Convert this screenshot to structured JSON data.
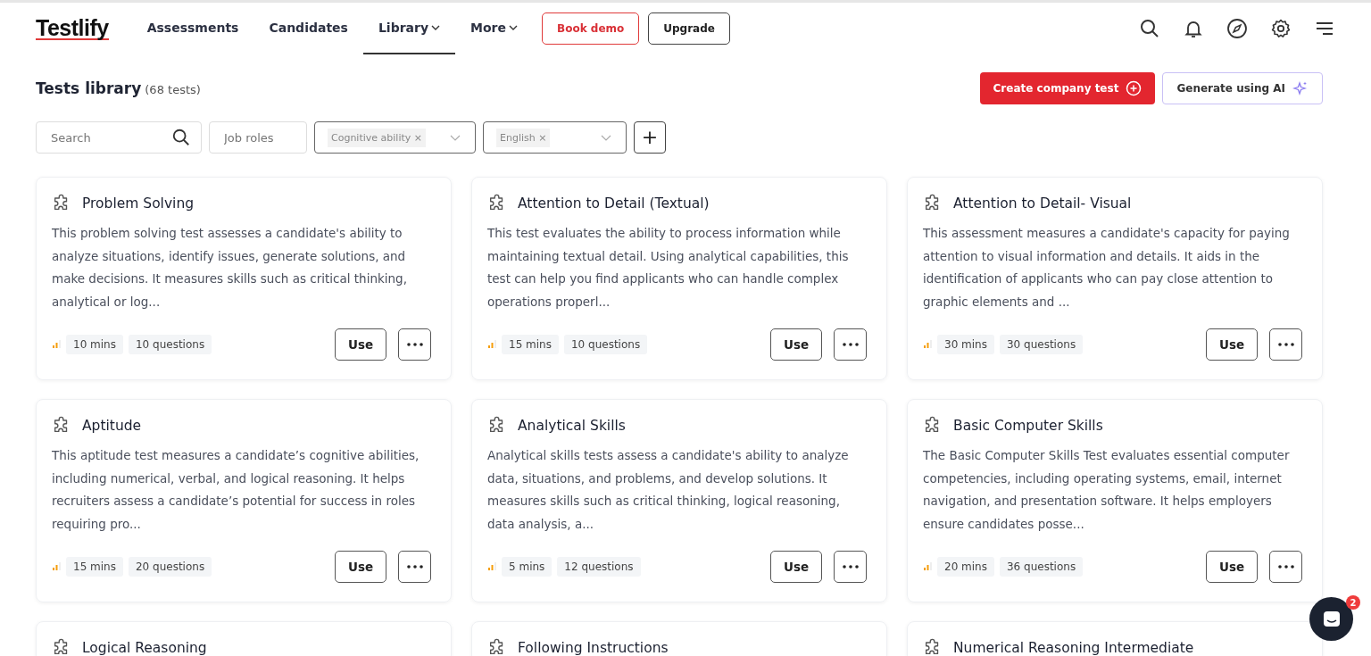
{
  "logo": "Testlify",
  "nav": [
    {
      "label": "Assessments",
      "dropdown": false,
      "selected": false
    },
    {
      "label": "Candidates",
      "dropdown": false,
      "selected": false
    },
    {
      "label": "Library",
      "dropdown": true,
      "selected": true
    },
    {
      "label": "More",
      "dropdown": true,
      "selected": false
    }
  ],
  "nav_buttons": [
    {
      "label": "Book demo",
      "kind": "outline-red"
    },
    {
      "label": "Upgrade",
      "kind": "outline"
    }
  ],
  "page": {
    "title": "Tests library",
    "count": "(68 tests)"
  },
  "actions": [
    {
      "label": "Create company test",
      "kind": "primary"
    },
    {
      "label": "Generate using AI",
      "kind": "ai"
    }
  ],
  "filters": {
    "search": {
      "placeholder": "Search"
    },
    "job_roles": {
      "placeholder": "Job roles"
    },
    "selects": [
      {
        "chip": "Cognitive ability ×"
      },
      {
        "chip": "English ×"
      }
    ],
    "add": "+"
  },
  "tests": [
    {
      "title": "Problem Solving",
      "description": "This problem solving test assesses a candidate's ability to analyze situations, identify issues, generate solutions, and make decisions. It measures skills such as critical thinking, analytical or log...",
      "duration": "10 mins",
      "questions": "10 questions",
      "use": "Use"
    },
    {
      "title": "Attention to Detail (Textual)",
      "description": "This test evaluates the ability to process information while maintaining textual detail. Using analytical capabilities, this test can help you find applicants who can handle complex operations properl...",
      "duration": "15 mins",
      "questions": "10 questions",
      "use": "Use"
    },
    {
      "title": "Attention to Detail- Visual",
      "description": "This assessment measures a candidate's capacity for paying attention to visual information and details. It aids in the identification of applicants who can pay close attention to graphic elements and ...",
      "duration": "30 mins",
      "questions": "30 questions",
      "use": "Use"
    },
    {
      "title": "Aptitude",
      "description": "This aptitude test measures a candidate’s cognitive abilities, including numerical, verbal, and logical reasoning. It helps recruiters assess a candidate’s potential for success in roles requiring pro...",
      "duration": "15 mins",
      "questions": "20 questions",
      "use": "Use"
    },
    {
      "title": "Analytical Skills",
      "description": "Analytical skills tests assess a candidate's ability to analyze data, situations, and problems, and develop solutions. It measures skills such as critical thinking, logical reasoning, data analysis, a...",
      "duration": "5 mins",
      "questions": "12 questions",
      "use": "Use"
    },
    {
      "title": "Basic Computer Skills",
      "description": "The Basic Computer Skills Test evaluates essential computer competencies, including operating systems, email, internet navigation, and presentation software. It helps employers ensure candidates posse...",
      "duration": "20 mins",
      "questions": "36 questions",
      "use": "Use"
    },
    {
      "title": "Logical Reasoning"
    },
    {
      "title": "Following Instructions"
    },
    {
      "title": "Numerical Reasoning Intermediate"
    }
  ],
  "chat": {
    "badge": "2"
  }
}
